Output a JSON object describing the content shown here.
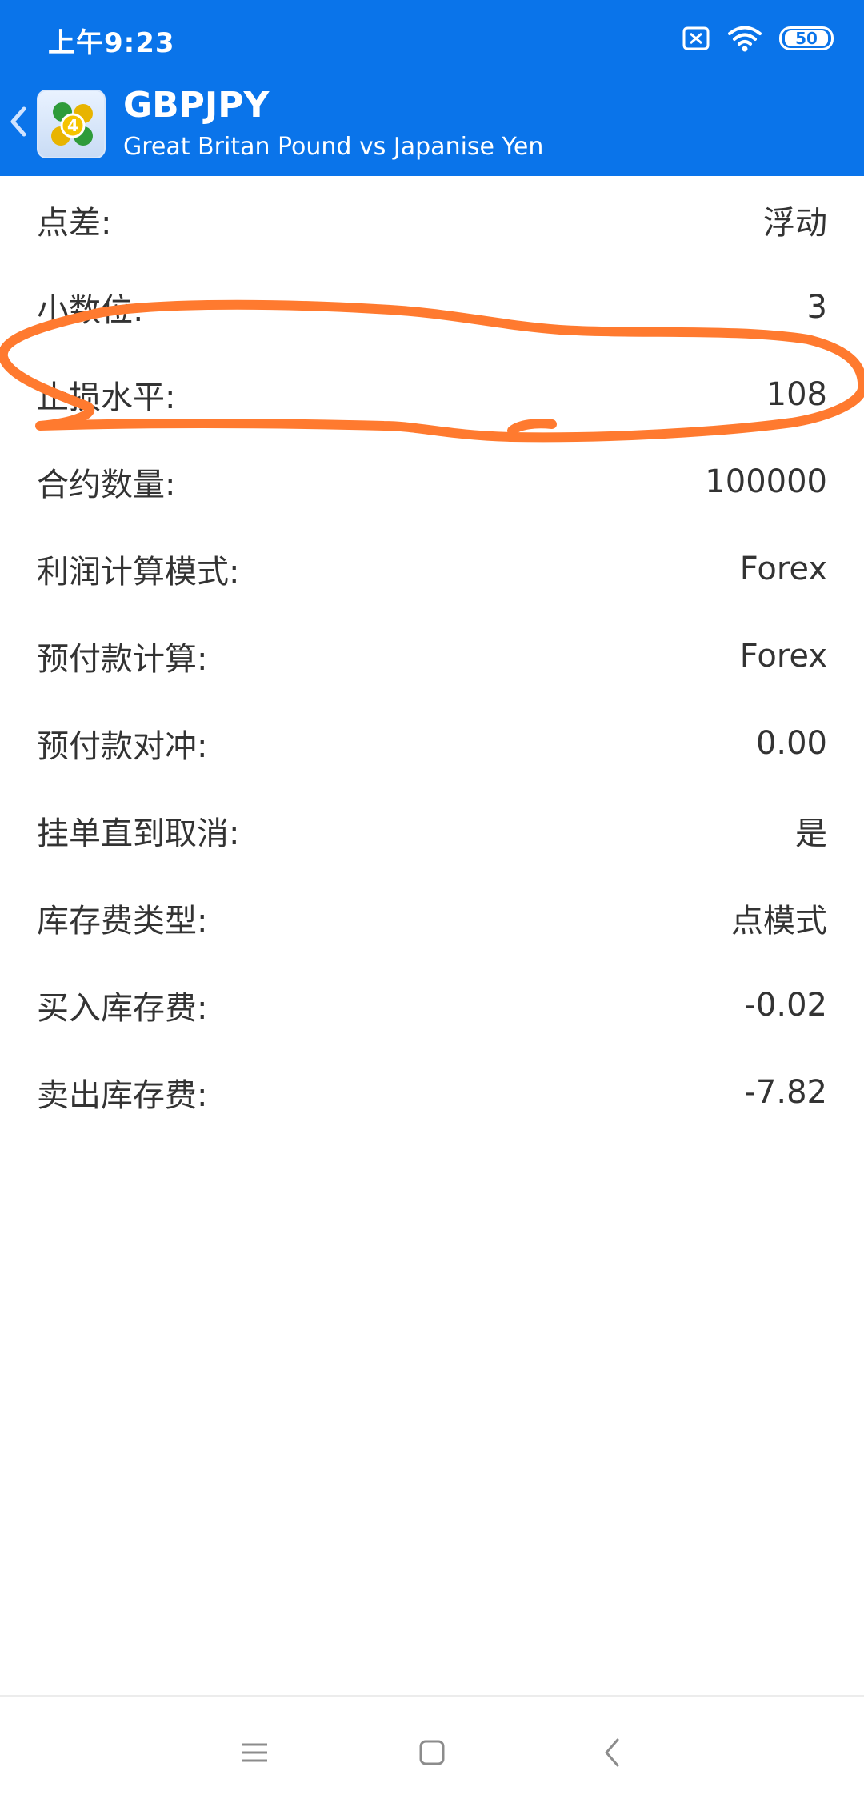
{
  "status_bar": {
    "time": "上午9:23",
    "battery": "50",
    "icons": [
      "sim-disabled-icon",
      "wifi-icon",
      "battery-icon"
    ]
  },
  "header": {
    "symbol": "GBPJPY",
    "description": "Great Britan Pound vs Japanise Yen",
    "icons": [
      "back-chevron-icon",
      "mt4-app-icon"
    ],
    "background_color": "#0a74ea"
  },
  "rows": [
    {
      "label": "点差:",
      "value": "浮动"
    },
    {
      "label": "小数位:",
      "value": "3"
    },
    {
      "label": "止损水平:",
      "value": "108"
    },
    {
      "label": "合约数量:",
      "value": "100000"
    },
    {
      "label": "利润计算模式:",
      "value": "Forex"
    },
    {
      "label": "预付款计算:",
      "value": "Forex"
    },
    {
      "label": "预付款对冲:",
      "value": "0.00"
    },
    {
      "label": "挂单直到取消:",
      "value": "是"
    },
    {
      "label": "库存费类型:",
      "value": "点模式"
    },
    {
      "label": "买入库存费:",
      "value": "-0.02"
    },
    {
      "label": "卖出库存费:",
      "value": "-7.82"
    }
  ],
  "annotation": {
    "color": "#ff7a2f"
  },
  "nav_bar": {
    "icons": [
      "menu-icon",
      "home-square-icon",
      "back-icon"
    ]
  }
}
